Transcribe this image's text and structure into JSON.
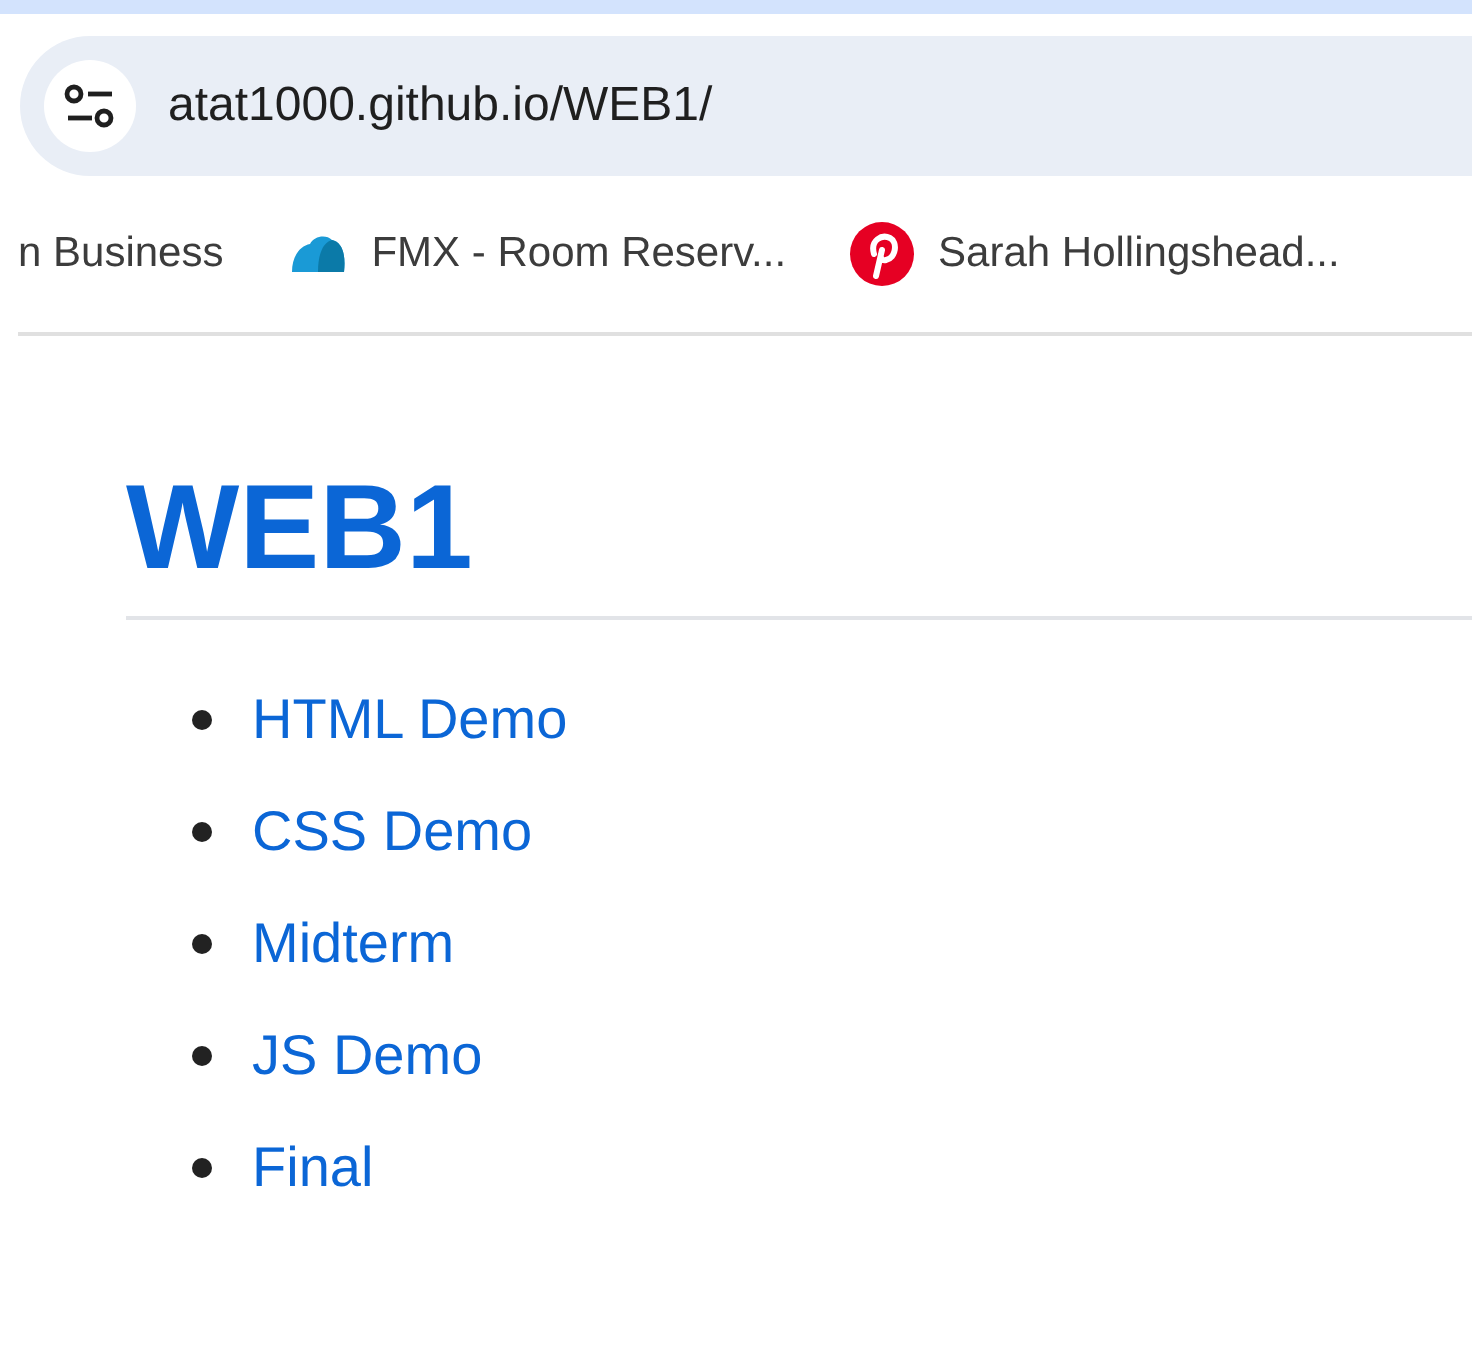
{
  "address_bar": {
    "url": "atat1000.github.io/WEB1/"
  },
  "bookmarks": [
    {
      "label": "n Business",
      "kind": "none"
    },
    {
      "label": "FMX - Room Reserv...",
      "kind": "cloud"
    },
    {
      "label": "Sarah Hollingshead...",
      "kind": "pin"
    }
  ],
  "page": {
    "heading": "WEB1",
    "links": [
      "HTML Demo",
      "CSS Demo",
      "Midterm",
      "JS Demo",
      "Final"
    ]
  }
}
